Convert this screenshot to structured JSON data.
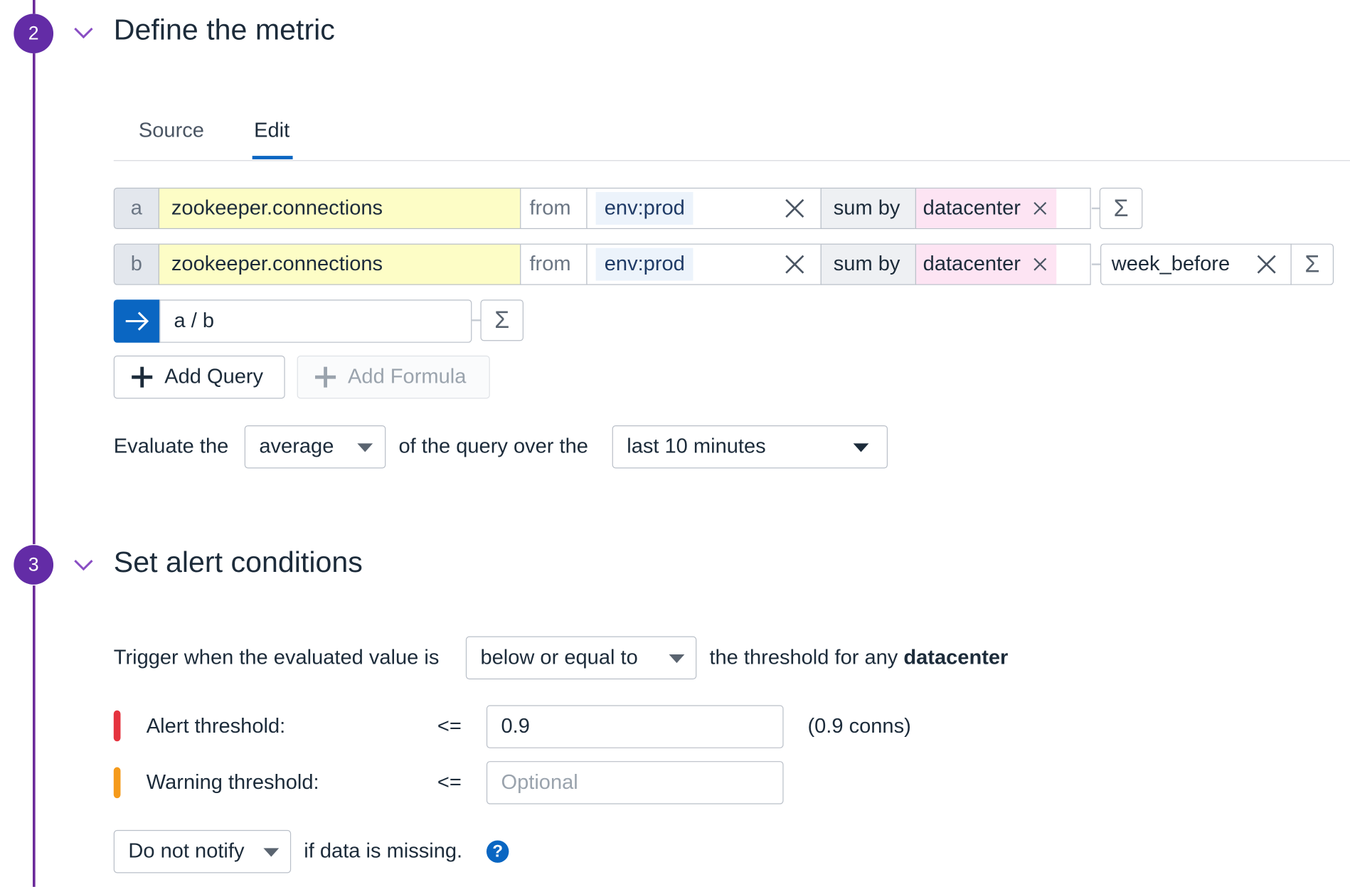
{
  "steps": [
    {
      "number": "2",
      "title": "Define the metric"
    },
    {
      "number": "3",
      "title": "Set alert conditions"
    }
  ],
  "tabs": [
    {
      "label": "Source"
    },
    {
      "label": "Edit",
      "active": true
    }
  ],
  "queries": [
    {
      "label": "a",
      "metric": "zookeeper.connections",
      "from_label": "from",
      "scope": "env:prod",
      "agg_label": "sum by",
      "group": "datacenter",
      "function": ""
    },
    {
      "label": "b",
      "metric": "zookeeper.connections",
      "from_label": "from",
      "scope": "env:prod",
      "agg_label": "sum by",
      "group": "datacenter",
      "function": "week_before"
    }
  ],
  "formula": {
    "expression": "a / b"
  },
  "buttons": {
    "add_query": "Add Query",
    "add_formula": "Add Formula"
  },
  "evaluate": {
    "prefix": "Evaluate the",
    "aggregation": "average",
    "middle": "of the query over the",
    "window": "last 10 minutes"
  },
  "trigger": {
    "prefix": "Trigger when the evaluated value is",
    "comparator": "below or equal to",
    "suffix_start": "the threshold for any",
    "suffix_group": "datacenter"
  },
  "thresholds": {
    "alert": {
      "label": "Alert threshold:",
      "operator": "<=",
      "value": "0.9",
      "note": "(0.9 conns)",
      "color": "#e5333f"
    },
    "warning": {
      "label": "Warning threshold:",
      "operator": "<=",
      "value": "",
      "placeholder": "Optional",
      "color": "#f59a1b"
    }
  },
  "missing_data": {
    "option": "Do not notify",
    "suffix": "if data is missing."
  },
  "colors": {
    "step": "#632ca6",
    "accent": "#0a66c2"
  }
}
